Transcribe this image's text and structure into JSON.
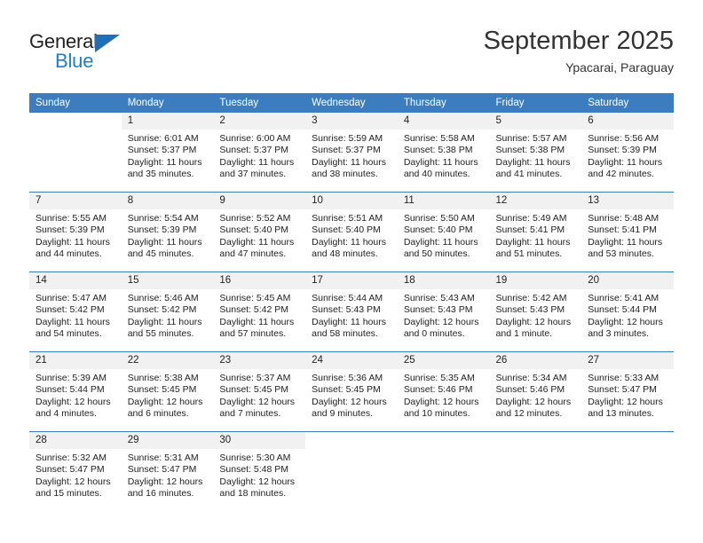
{
  "brand": {
    "name_top": "General",
    "name_bottom": "Blue",
    "accent_color": "#1b7fd4",
    "triangle_color": "#1f6fb8"
  },
  "header": {
    "title": "September 2025",
    "subtitle": "Ypacarai, Paraguay"
  },
  "calendar": {
    "header_bg": "#3b7dbf",
    "daynum_bg": "#f1f1f1",
    "weekdays": [
      "Sunday",
      "Monday",
      "Tuesday",
      "Wednesday",
      "Thursday",
      "Friday",
      "Saturday"
    ],
    "weeks": [
      [
        {
          "day": "",
          "sunrise": "",
          "sunset": "",
          "daylight1": "",
          "daylight2": "",
          "blank": true
        },
        {
          "day": "1",
          "sunrise": "Sunrise: 6:01 AM",
          "sunset": "Sunset: 5:37 PM",
          "daylight1": "Daylight: 11 hours",
          "daylight2": "and 35 minutes."
        },
        {
          "day": "2",
          "sunrise": "Sunrise: 6:00 AM",
          "sunset": "Sunset: 5:37 PM",
          "daylight1": "Daylight: 11 hours",
          "daylight2": "and 37 minutes."
        },
        {
          "day": "3",
          "sunrise": "Sunrise: 5:59 AM",
          "sunset": "Sunset: 5:37 PM",
          "daylight1": "Daylight: 11 hours",
          "daylight2": "and 38 minutes."
        },
        {
          "day": "4",
          "sunrise": "Sunrise: 5:58 AM",
          "sunset": "Sunset: 5:38 PM",
          "daylight1": "Daylight: 11 hours",
          "daylight2": "and 40 minutes."
        },
        {
          "day": "5",
          "sunrise": "Sunrise: 5:57 AM",
          "sunset": "Sunset: 5:38 PM",
          "daylight1": "Daylight: 11 hours",
          "daylight2": "and 41 minutes."
        },
        {
          "day": "6",
          "sunrise": "Sunrise: 5:56 AM",
          "sunset": "Sunset: 5:39 PM",
          "daylight1": "Daylight: 11 hours",
          "daylight2": "and 42 minutes."
        }
      ],
      [
        {
          "day": "7",
          "sunrise": "Sunrise: 5:55 AM",
          "sunset": "Sunset: 5:39 PM",
          "daylight1": "Daylight: 11 hours",
          "daylight2": "and 44 minutes."
        },
        {
          "day": "8",
          "sunrise": "Sunrise: 5:54 AM",
          "sunset": "Sunset: 5:39 PM",
          "daylight1": "Daylight: 11 hours",
          "daylight2": "and 45 minutes."
        },
        {
          "day": "9",
          "sunrise": "Sunrise: 5:52 AM",
          "sunset": "Sunset: 5:40 PM",
          "daylight1": "Daylight: 11 hours",
          "daylight2": "and 47 minutes."
        },
        {
          "day": "10",
          "sunrise": "Sunrise: 5:51 AM",
          "sunset": "Sunset: 5:40 PM",
          "daylight1": "Daylight: 11 hours",
          "daylight2": "and 48 minutes."
        },
        {
          "day": "11",
          "sunrise": "Sunrise: 5:50 AM",
          "sunset": "Sunset: 5:40 PM",
          "daylight1": "Daylight: 11 hours",
          "daylight2": "and 50 minutes."
        },
        {
          "day": "12",
          "sunrise": "Sunrise: 5:49 AM",
          "sunset": "Sunset: 5:41 PM",
          "daylight1": "Daylight: 11 hours",
          "daylight2": "and 51 minutes."
        },
        {
          "day": "13",
          "sunrise": "Sunrise: 5:48 AM",
          "sunset": "Sunset: 5:41 PM",
          "daylight1": "Daylight: 11 hours",
          "daylight2": "and 53 minutes."
        }
      ],
      [
        {
          "day": "14",
          "sunrise": "Sunrise: 5:47 AM",
          "sunset": "Sunset: 5:42 PM",
          "daylight1": "Daylight: 11 hours",
          "daylight2": "and 54 minutes."
        },
        {
          "day": "15",
          "sunrise": "Sunrise: 5:46 AM",
          "sunset": "Sunset: 5:42 PM",
          "daylight1": "Daylight: 11 hours",
          "daylight2": "and 55 minutes."
        },
        {
          "day": "16",
          "sunrise": "Sunrise: 5:45 AM",
          "sunset": "Sunset: 5:42 PM",
          "daylight1": "Daylight: 11 hours",
          "daylight2": "and 57 minutes."
        },
        {
          "day": "17",
          "sunrise": "Sunrise: 5:44 AM",
          "sunset": "Sunset: 5:43 PM",
          "daylight1": "Daylight: 11 hours",
          "daylight2": "and 58 minutes."
        },
        {
          "day": "18",
          "sunrise": "Sunrise: 5:43 AM",
          "sunset": "Sunset: 5:43 PM",
          "daylight1": "Daylight: 12 hours",
          "daylight2": "and 0 minutes."
        },
        {
          "day": "19",
          "sunrise": "Sunrise: 5:42 AM",
          "sunset": "Sunset: 5:43 PM",
          "daylight1": "Daylight: 12 hours",
          "daylight2": "and 1 minute."
        },
        {
          "day": "20",
          "sunrise": "Sunrise: 5:41 AM",
          "sunset": "Sunset: 5:44 PM",
          "daylight1": "Daylight: 12 hours",
          "daylight2": "and 3 minutes."
        }
      ],
      [
        {
          "day": "21",
          "sunrise": "Sunrise: 5:39 AM",
          "sunset": "Sunset: 5:44 PM",
          "daylight1": "Daylight: 12 hours",
          "daylight2": "and 4 minutes."
        },
        {
          "day": "22",
          "sunrise": "Sunrise: 5:38 AM",
          "sunset": "Sunset: 5:45 PM",
          "daylight1": "Daylight: 12 hours",
          "daylight2": "and 6 minutes."
        },
        {
          "day": "23",
          "sunrise": "Sunrise: 5:37 AM",
          "sunset": "Sunset: 5:45 PM",
          "daylight1": "Daylight: 12 hours",
          "daylight2": "and 7 minutes."
        },
        {
          "day": "24",
          "sunrise": "Sunrise: 5:36 AM",
          "sunset": "Sunset: 5:45 PM",
          "daylight1": "Daylight: 12 hours",
          "daylight2": "and 9 minutes."
        },
        {
          "day": "25",
          "sunrise": "Sunrise: 5:35 AM",
          "sunset": "Sunset: 5:46 PM",
          "daylight1": "Daylight: 12 hours",
          "daylight2": "and 10 minutes."
        },
        {
          "day": "26",
          "sunrise": "Sunrise: 5:34 AM",
          "sunset": "Sunset: 5:46 PM",
          "daylight1": "Daylight: 12 hours",
          "daylight2": "and 12 minutes."
        },
        {
          "day": "27",
          "sunrise": "Sunrise: 5:33 AM",
          "sunset": "Sunset: 5:47 PM",
          "daylight1": "Daylight: 12 hours",
          "daylight2": "and 13 minutes."
        }
      ],
      [
        {
          "day": "28",
          "sunrise": "Sunrise: 5:32 AM",
          "sunset": "Sunset: 5:47 PM",
          "daylight1": "Daylight: 12 hours",
          "daylight2": "and 15 minutes."
        },
        {
          "day": "29",
          "sunrise": "Sunrise: 5:31 AM",
          "sunset": "Sunset: 5:47 PM",
          "daylight1": "Daylight: 12 hours",
          "daylight2": "and 16 minutes."
        },
        {
          "day": "30",
          "sunrise": "Sunrise: 5:30 AM",
          "sunset": "Sunset: 5:48 PM",
          "daylight1": "Daylight: 12 hours",
          "daylight2": "and 18 minutes."
        },
        {
          "day": "",
          "sunrise": "",
          "sunset": "",
          "daylight1": "",
          "daylight2": "",
          "blank": true
        },
        {
          "day": "",
          "sunrise": "",
          "sunset": "",
          "daylight1": "",
          "daylight2": "",
          "blank": true
        },
        {
          "day": "",
          "sunrise": "",
          "sunset": "",
          "daylight1": "",
          "daylight2": "",
          "blank": true
        },
        {
          "day": "",
          "sunrise": "",
          "sunset": "",
          "daylight1": "",
          "daylight2": "",
          "blank": true
        }
      ]
    ]
  }
}
